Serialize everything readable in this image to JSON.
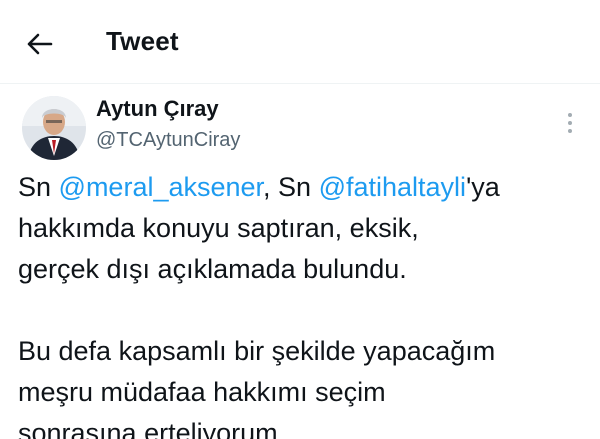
{
  "header": {
    "back_icon": "arrow-left-icon",
    "title": "Tweet"
  },
  "author": {
    "name": "Aytun Çıray",
    "handle": "@TCAytunCiray",
    "avatar_icon": "profile-photo"
  },
  "more_icon": "vertical-ellipsis-icon",
  "tweet": {
    "line1": {
      "t1": "Sn ",
      "m1": "@meral_aksener",
      "t2": ", Sn ",
      "m2": "@fatihaltayli",
      "t3": "'ya"
    },
    "line2": "hakkımda konuyu saptıran, eksik,",
    "line3": "gerçek dışı açıklamada bulundu.",
    "line4": "Bu defa kapsamlı bir şekilde yapacağım",
    "line5": "meşru müdafaa hakkımı seçim",
    "line6": "sonrasına erteliyorum."
  },
  "colors": {
    "mention": "#1d9bf0",
    "text": "#0f1419",
    "secondary_text": "#536471"
  }
}
